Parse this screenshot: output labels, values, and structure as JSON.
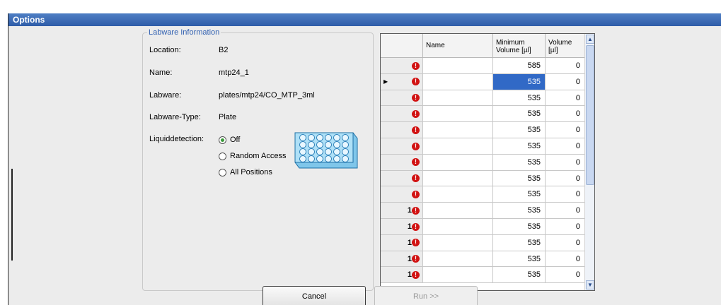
{
  "window": {
    "title": "Options"
  },
  "labware": {
    "group_title": "Labware Information",
    "fields": [
      {
        "label": "Location:",
        "value": "B2"
      },
      {
        "label": "Name:",
        "value": "mtp24_1"
      },
      {
        "label": "Labware:",
        "value": "plates/mtp24/CO_MTP_3ml"
      },
      {
        "label": "Labware-Type:",
        "value": "Plate"
      }
    ],
    "liquiddetection_label": "Liquiddetection:",
    "liquiddetection_options": [
      "Off",
      "Random Access",
      "All Positions"
    ],
    "liquiddetection_selected": "Off"
  },
  "table": {
    "columns": [
      "",
      "Name",
      "Minimum Volume [µl]",
      "Volume [µl]"
    ],
    "rows": [
      {
        "index": "",
        "name": "",
        "min_volume": "585",
        "volume": "0"
      },
      {
        "index": "",
        "name": "",
        "min_volume": "535",
        "volume": "0",
        "current": true,
        "selected": true
      },
      {
        "index": "",
        "name": "",
        "min_volume": "535",
        "volume": "0"
      },
      {
        "index": "",
        "name": "",
        "min_volume": "535",
        "volume": "0"
      },
      {
        "index": "",
        "name": "",
        "min_volume": "535",
        "volume": "0"
      },
      {
        "index": "",
        "name": "",
        "min_volume": "535",
        "volume": "0"
      },
      {
        "index": "",
        "name": "",
        "min_volume": "535",
        "volume": "0"
      },
      {
        "index": "",
        "name": "",
        "min_volume": "535",
        "volume": "0"
      },
      {
        "index": "",
        "name": "",
        "min_volume": "535",
        "volume": "0"
      },
      {
        "index": "1",
        "name": "",
        "min_volume": "535",
        "volume": "0"
      },
      {
        "index": "1",
        "name": "",
        "min_volume": "535",
        "volume": "0"
      },
      {
        "index": "1",
        "name": "",
        "min_volume": "535",
        "volume": "0"
      },
      {
        "index": "1",
        "name": "",
        "min_volume": "535",
        "volume": "0"
      },
      {
        "index": "1",
        "name": "",
        "min_volume": "535",
        "volume": "0"
      }
    ],
    "error_icon": "error-exclamation-icon"
  },
  "buttons": {
    "cancel": "Cancel",
    "run": "Run >>"
  },
  "colors": {
    "titlebar": "#2e5ca8",
    "selection": "#3169c6",
    "error": "#d11212",
    "group_title": "#2f5fb0"
  }
}
